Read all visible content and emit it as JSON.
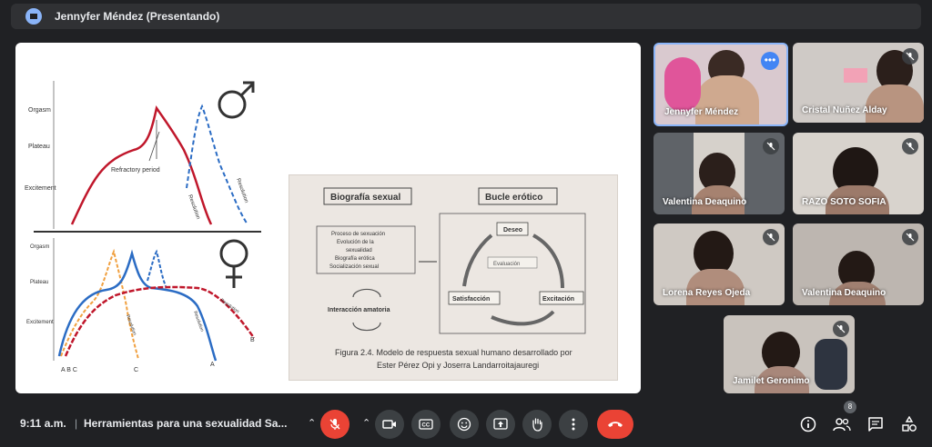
{
  "presenting_bar": {
    "title": "Jennyfer Méndez (Presentando)"
  },
  "slide": {
    "male": {
      "y_labels": [
        "Orgasm",
        "Plateau",
        "Excitement"
      ],
      "curve_labels": [
        "Refractory period",
        "Resolution",
        "Resolution"
      ]
    },
    "female": {
      "y_labels": [
        "Orgasm",
        "Plateau",
        "Excitement"
      ],
      "curve_labels": [
        "Resolution",
        "Resolution",
        "Resolution"
      ],
      "x_labels": [
        "A B C",
        "C",
        "A",
        "B"
      ]
    },
    "book": {
      "left_title": "Biografía sexual",
      "left_items": [
        "Proceso de sexuación",
        "Evolución de la",
        "sexualidad",
        "Biografía erótica",
        "Socialización sexual"
      ],
      "interaction": "Interacción amatoria",
      "right_title": "Bucle erótico",
      "nodes": [
        "Deseo",
        "Evaluación",
        "Satisfacción",
        "Excitación"
      ],
      "caption_line1": "Figura 2.4. Modelo de respuesta sexual humano desarrollado por",
      "caption_line2": "Ester Pérez Opi y Joserra Landarroitajauregi"
    }
  },
  "participants": [
    {
      "name": "Jennyfer Méndez",
      "muted": false,
      "speaking": true
    },
    {
      "name": "Cristal Nuñez Alday",
      "muted": true
    },
    {
      "name": "Valentina Deaquino",
      "muted": true
    },
    {
      "name": "RAZO SOTO SOFIA",
      "muted": true
    },
    {
      "name": "Lorena Reyes Ojeda",
      "muted": true
    },
    {
      "name": "Valentina Deaquino",
      "muted": true
    },
    {
      "name": "Jamilet Geronimo",
      "muted": true
    }
  ],
  "bottom_bar": {
    "time": "9:11 a.m.",
    "separator": "|",
    "meeting_title": "Herramientas para una sexualidad Sa...",
    "participant_count": "8"
  },
  "colors": {
    "background": "#202124",
    "end_call": "#ea4335",
    "male_curve": "#c0172b",
    "dashed_blue": "#2b6cc4",
    "female_orange": "#f0a040"
  }
}
